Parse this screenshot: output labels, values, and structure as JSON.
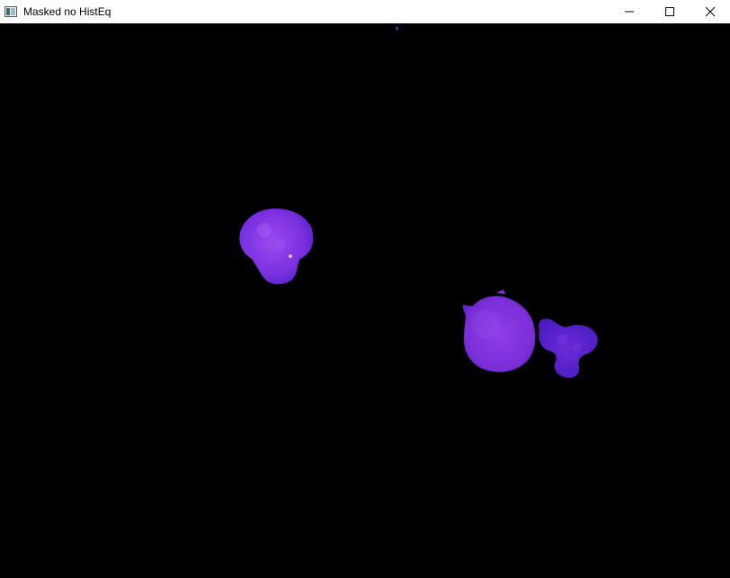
{
  "window": {
    "title": "Masked no HistEq",
    "icon": "opencv-window-icon",
    "controls": [
      "minimize-icon",
      "maximize-icon",
      "close-icon"
    ]
  },
  "canvas": {
    "background": "#000000",
    "content": "masked-image",
    "colors": {
      "cell_light": "#8a3ee8",
      "cell_mid": "#6f2ad6",
      "cell_dark": "#4a1cc0"
    }
  }
}
